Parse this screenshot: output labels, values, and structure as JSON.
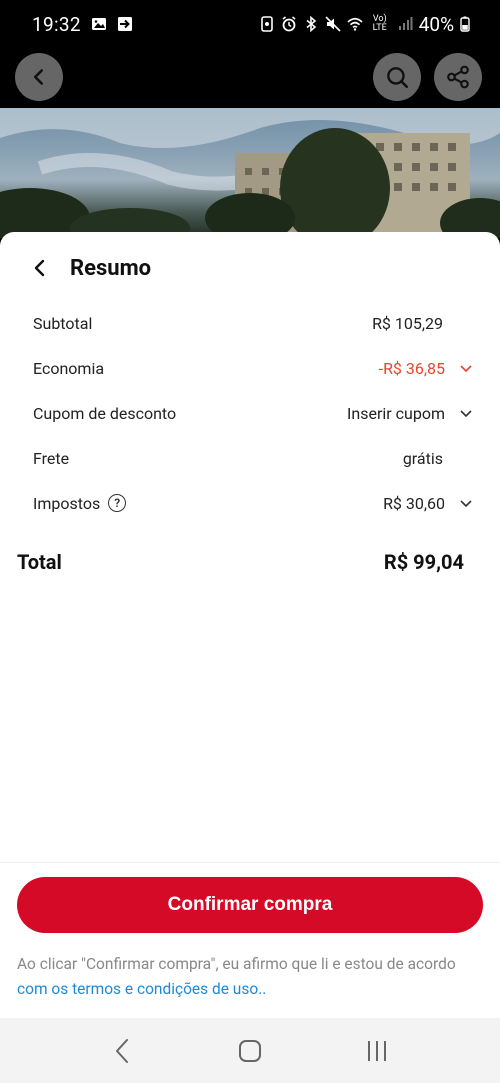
{
  "status_bar": {
    "time": "19:32",
    "battery": "40%",
    "network": "Vo) LTE"
  },
  "sheet": {
    "title": "Resumo"
  },
  "summary": {
    "rows": [
      {
        "label": "Subtotal",
        "value": "R$ 105,29",
        "expandable": false,
        "color": "#222222"
      },
      {
        "label": "Economia",
        "value": "-R$ 36,85",
        "expandable": true,
        "color": "#e8452f"
      },
      {
        "label": "Cupom de desconto",
        "value": "Inserir cupom",
        "expandable": true,
        "color": "#222222"
      },
      {
        "label": "Frete",
        "value": "grátis",
        "expandable": false,
        "color": "#222222"
      },
      {
        "label": "Impostos",
        "value": "R$ 30,60",
        "expandable": true,
        "help": true,
        "color": "#222222"
      }
    ],
    "help_symbol": "?",
    "total_label": "Total",
    "total_value": "R$ 99,04"
  },
  "actions": {
    "confirm_label": "Confirmar compra"
  },
  "legal": {
    "text": "Ao clicar \"Confirmar compra\", eu afirmo que li e estou de acordo ",
    "link": "com os termos e condições de uso.."
  },
  "colors": {
    "brand_red": "#d40a27",
    "discount_red": "#e8452f",
    "link_blue": "#1e8ad6"
  }
}
